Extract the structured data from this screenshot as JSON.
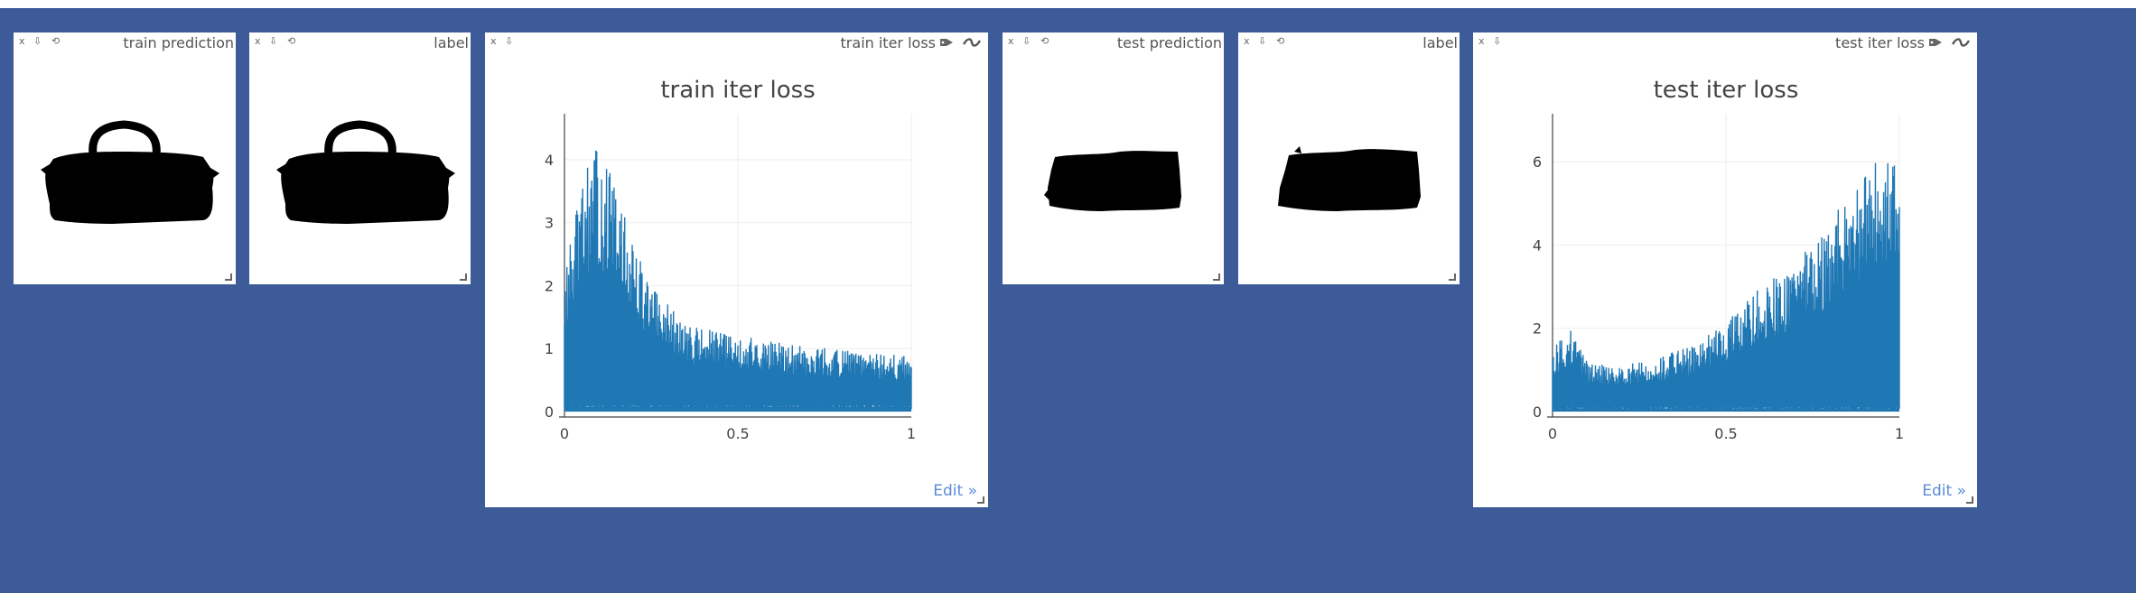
{
  "panes": [
    {
      "type": "image",
      "title": "train prediction",
      "controls": [
        "x",
        "⇩",
        "⟲"
      ],
      "shape": "bag"
    },
    {
      "type": "image",
      "title": "label",
      "controls": [
        "x",
        "⇩",
        "⟲"
      ],
      "shape": "bag"
    },
    {
      "type": "chart",
      "title": "train iter loss",
      "controls": [
        "x",
        "⇩"
      ],
      "edit": "Edit »"
    },
    {
      "type": "image",
      "title": "test prediction",
      "controls": [
        "x",
        "⇩",
        "⟲"
      ],
      "shape": "blob"
    },
    {
      "type": "image",
      "title": "label",
      "controls": [
        "x",
        "⇩",
        "⟲"
      ],
      "shape": "blob"
    },
    {
      "type": "chart",
      "title": "test iter loss",
      "controls": [
        "x",
        "⇩"
      ],
      "edit": "Edit »"
    }
  ],
  "colors": {
    "background": "#3d5b99",
    "series": "#1f77b4"
  },
  "icons": [
    "close-icon",
    "download-icon",
    "reset-icon",
    "tag-icon",
    "smooth-icon",
    "resize-handle-icon"
  ],
  "chart_data": [
    {
      "type": "line",
      "title": "train iter loss",
      "xlim": [
        0,
        1
      ],
      "ylim": [
        0,
        4.3
      ],
      "x_ticks": [
        "0",
        "0.5",
        "1"
      ],
      "y_ticks": [
        "0",
        "1",
        "2",
        "3",
        "4"
      ],
      "grid": true,
      "series": [
        {
          "values_envelope": [
            {
              "x": 0.0,
              "y": 2.1
            },
            {
              "x": 0.02,
              "y": 2.8
            },
            {
              "x": 0.05,
              "y": 3.6
            },
            {
              "x": 0.08,
              "y": 4.2
            },
            {
              "x": 0.12,
              "y": 4.0
            },
            {
              "x": 0.18,
              "y": 3.0
            },
            {
              "x": 0.25,
              "y": 2.0
            },
            {
              "x": 0.35,
              "y": 1.4
            },
            {
              "x": 0.5,
              "y": 1.2
            },
            {
              "x": 0.7,
              "y": 1.05
            },
            {
              "x": 0.85,
              "y": 0.95
            },
            {
              "x": 1.0,
              "y": 0.88
            }
          ]
        }
      ]
    },
    {
      "type": "line",
      "title": "test iter loss",
      "xlim": [
        0,
        1
      ],
      "ylim": [
        0,
        6.5
      ],
      "x_ticks": [
        "0",
        "0.5",
        "1"
      ],
      "y_ticks": [
        "0",
        "2",
        "4",
        "6"
      ],
      "grid": true,
      "series": [
        {
          "values_envelope": [
            {
              "x": 0.0,
              "y": 1.5
            },
            {
              "x": 0.05,
              "y": 2.0
            },
            {
              "x": 0.1,
              "y": 1.2
            },
            {
              "x": 0.2,
              "y": 1.1
            },
            {
              "x": 0.3,
              "y": 1.3
            },
            {
              "x": 0.4,
              "y": 1.6
            },
            {
              "x": 0.5,
              "y": 2.2
            },
            {
              "x": 0.6,
              "y": 3.0
            },
            {
              "x": 0.7,
              "y": 3.6
            },
            {
              "x": 0.8,
              "y": 4.6
            },
            {
              "x": 0.9,
              "y": 5.8
            },
            {
              "x": 1.0,
              "y": 6.4
            }
          ]
        }
      ]
    }
  ]
}
